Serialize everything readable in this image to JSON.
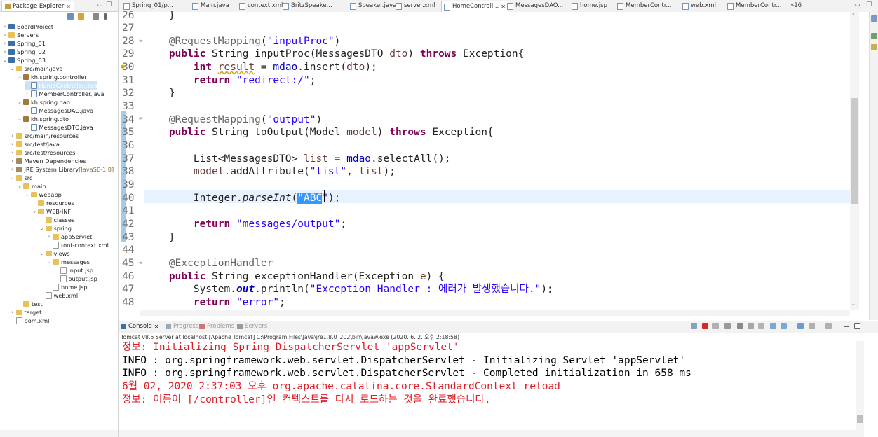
{
  "package_explorer": {
    "title": "Package Explorer",
    "tree": [
      {
        "label": "BoardProject",
        "depth": 0,
        "icon": "project",
        "toggle": "collapsed"
      },
      {
        "label": "Servers",
        "depth": 0,
        "icon": "folder",
        "toggle": "collapsed"
      },
      {
        "label": "Spring_01",
        "depth": 0,
        "icon": "project",
        "toggle": "collapsed"
      },
      {
        "label": "Spring_02",
        "depth": 0,
        "icon": "project",
        "toggle": "collapsed"
      },
      {
        "label": "Spring_03",
        "depth": 0,
        "icon": "project",
        "toggle": "expanded"
      },
      {
        "label": "src/main/java",
        "depth": 1,
        "icon": "folder",
        "toggle": "expanded"
      },
      {
        "label": "kh.spring.controller",
        "depth": 2,
        "icon": "package",
        "toggle": "expanded"
      },
      {
        "label": "HomeController.java",
        "depth": 3,
        "icon": "java",
        "toggle": "collapsed",
        "selected": true
      },
      {
        "label": "MemberController.java",
        "depth": 3,
        "icon": "java",
        "toggle": "collapsed"
      },
      {
        "label": "kh.spring.dao",
        "depth": 2,
        "icon": "package",
        "toggle": "expanded"
      },
      {
        "label": "MessagesDAO.java",
        "depth": 3,
        "icon": "java",
        "toggle": "collapsed"
      },
      {
        "label": "kh.spring.dto",
        "depth": 2,
        "icon": "package",
        "toggle": "expanded"
      },
      {
        "label": "MessagesDTO.java",
        "depth": 3,
        "icon": "java",
        "toggle": "collapsed"
      },
      {
        "label": "src/main/resources",
        "depth": 1,
        "icon": "folder",
        "toggle": "collapsed"
      },
      {
        "label": "src/test/java",
        "depth": 1,
        "icon": "folder",
        "toggle": "collapsed"
      },
      {
        "label": "src/test/resources",
        "depth": 1,
        "icon": "folder",
        "toggle": "collapsed"
      },
      {
        "label": "Maven Dependencies",
        "depth": 1,
        "icon": "library",
        "toggle": "collapsed"
      },
      {
        "label": "JRE System Library",
        "suffix": " [JavaSE-1.8]",
        "depth": 1,
        "icon": "library",
        "toggle": "collapsed"
      },
      {
        "label": "src",
        "depth": 1,
        "icon": "folder",
        "toggle": "expanded"
      },
      {
        "label": "main",
        "depth": 2,
        "icon": "folder",
        "toggle": "expanded"
      },
      {
        "label": "webapp",
        "depth": 3,
        "icon": "folder",
        "toggle": "expanded"
      },
      {
        "label": "resources",
        "depth": 4,
        "icon": "folder",
        "toggle": "none"
      },
      {
        "label": "WEB-INF",
        "depth": 4,
        "icon": "folder",
        "toggle": "expanded"
      },
      {
        "label": "classes",
        "depth": 5,
        "icon": "folder",
        "toggle": "none"
      },
      {
        "label": "spring",
        "depth": 5,
        "icon": "folder",
        "toggle": "expanded"
      },
      {
        "label": "appServlet",
        "depth": 6,
        "icon": "folder",
        "toggle": "collapsed"
      },
      {
        "label": "root-context.xml",
        "depth": 6,
        "icon": "file",
        "toggle": "none"
      },
      {
        "label": "views",
        "depth": 5,
        "icon": "folder",
        "toggle": "expanded"
      },
      {
        "label": "messages",
        "depth": 6,
        "icon": "folder",
        "toggle": "expanded"
      },
      {
        "label": "input.jsp",
        "depth": 7,
        "icon": "file",
        "toggle": "none"
      },
      {
        "label": "output.jsp",
        "depth": 7,
        "icon": "file",
        "toggle": "none"
      },
      {
        "label": "home.jsp",
        "depth": 6,
        "icon": "file",
        "toggle": "none"
      },
      {
        "label": "web.xml",
        "depth": 5,
        "icon": "file",
        "toggle": "none"
      },
      {
        "label": "test",
        "depth": 2,
        "icon": "folder",
        "toggle": "none"
      },
      {
        "label": "target",
        "depth": 1,
        "icon": "folder",
        "toggle": "collapsed"
      },
      {
        "label": "pom.xml",
        "depth": 1,
        "icon": "file",
        "toggle": "none"
      }
    ]
  },
  "editor_tabs": [
    {
      "label": "Spring_01/p..."
    },
    {
      "label": "Main.java"
    },
    {
      "label": "context.xml"
    },
    {
      "label": "BritzSpeake..."
    },
    {
      "label": "Speaker.java"
    },
    {
      "label": "server.xml"
    },
    {
      "label": "HomeControll...",
      "active": true
    },
    {
      "label": "MessagesDAO..."
    },
    {
      "label": "home.jsp"
    },
    {
      "label": "MemberContr..."
    },
    {
      "label": "web.xml"
    },
    {
      "label": "MemberContr..."
    },
    {
      "label": "»26"
    }
  ],
  "editor": {
    "lines": [
      {
        "n": "26",
        "tokens": [
          [
            "t",
            "    }"
          ]
        ]
      },
      {
        "n": "27",
        "tokens": []
      },
      {
        "n": "28",
        "fold": true,
        "tokens": [
          [
            "ann",
            "    @RequestMapping"
          ],
          [
            "t",
            "("
          ],
          [
            "str",
            "\"inputProc\""
          ],
          [
            "t",
            ")"
          ]
        ]
      },
      {
        "n": "29",
        "tokens": [
          [
            "kw",
            "    public"
          ],
          [
            "t",
            " String inputProc(MessagesDTO "
          ],
          [
            "var",
            "dto"
          ],
          [
            "t",
            ") "
          ],
          [
            "kw",
            "throws"
          ],
          [
            "t",
            " Exception{"
          ]
        ]
      },
      {
        "n": "30",
        "warn": true,
        "tokens": [
          [
            "kw",
            "        int"
          ],
          [
            "t",
            " "
          ],
          [
            "var",
            "result"
          ],
          [
            "t",
            " = "
          ],
          [
            "fld",
            "mdao"
          ],
          [
            "t",
            ".insert("
          ],
          [
            "var",
            "dto"
          ],
          [
            "t",
            ");"
          ]
        ]
      },
      {
        "n": "31",
        "tokens": [
          [
            "kw",
            "        return"
          ],
          [
            "t",
            " "
          ],
          [
            "str",
            "\"redirect:/\""
          ],
          [
            "t",
            ";"
          ]
        ]
      },
      {
        "n": "32",
        "tokens": [
          [
            "t",
            "    }"
          ]
        ]
      },
      {
        "n": "33",
        "tokens": []
      },
      {
        "n": "34",
        "fold": true,
        "tokens": [
          [
            "ann",
            "    @RequestMapping"
          ],
          [
            "t",
            "("
          ],
          [
            "str",
            "\"output\""
          ],
          [
            "t",
            ")"
          ]
        ]
      },
      {
        "n": "35",
        "tokens": [
          [
            "kw",
            "    public"
          ],
          [
            "t",
            " String toOutput(Model "
          ],
          [
            "var",
            "model"
          ],
          [
            "t",
            ") "
          ],
          [
            "kw",
            "throws"
          ],
          [
            "t",
            " Exception{"
          ]
        ]
      },
      {
        "n": "36",
        "tokens": []
      },
      {
        "n": "37",
        "tokens": [
          [
            "t",
            "        List<MessagesDTO> "
          ],
          [
            "var",
            "list"
          ],
          [
            "t",
            " = "
          ],
          [
            "fld",
            "mdao"
          ],
          [
            "t",
            ".selectAll();"
          ]
        ]
      },
      {
        "n": "38",
        "tokens": [
          [
            "t",
            "        "
          ],
          [
            "var",
            "model"
          ],
          [
            "t",
            ".addAttribute("
          ],
          [
            "str",
            "\"list\""
          ],
          [
            "t",
            ", "
          ],
          [
            "var",
            "list"
          ],
          [
            "t",
            ");"
          ]
        ]
      },
      {
        "n": "39",
        "tokens": []
      },
      {
        "n": "40",
        "current": true,
        "tokens": [
          [
            "t",
            "        Integer."
          ],
          [
            "it",
            "parseInt"
          ],
          [
            "t",
            "("
          ],
          [
            "sel",
            "\"ABC"
          ],
          [
            "str",
            "\""
          ],
          [
            "t",
            ");"
          ]
        ]
      },
      {
        "n": "41",
        "tokens": []
      },
      {
        "n": "42",
        "tokens": [
          [
            "kw",
            "        return"
          ],
          [
            "t",
            " "
          ],
          [
            "str",
            "\"messages/output\""
          ],
          [
            "t",
            ";"
          ]
        ]
      },
      {
        "n": "43",
        "tokens": [
          [
            "t",
            "    }"
          ]
        ]
      },
      {
        "n": "44",
        "tokens": []
      },
      {
        "n": "45",
        "fold": true,
        "tokens": [
          [
            "ann",
            "    @ExceptionHandler"
          ]
        ]
      },
      {
        "n": "46",
        "tokens": [
          [
            "kw",
            "    public"
          ],
          [
            "t",
            " String exceptionHandler(Exception "
          ],
          [
            "var",
            "e"
          ],
          [
            "t",
            ") {"
          ]
        ]
      },
      {
        "n": "47",
        "tokens": [
          [
            "t",
            "        System."
          ],
          [
            "fldit",
            "out"
          ],
          [
            "t",
            ".println("
          ],
          [
            "str",
            "\"Exception Handler : 에러가 발생했습니다.\""
          ],
          [
            "t",
            ");"
          ]
        ]
      },
      {
        "n": "48",
        "tokens": [
          [
            "kw",
            "        return"
          ],
          [
            "t",
            " "
          ],
          [
            "str",
            "\"error\""
          ],
          [
            "t",
            ";"
          ]
        ]
      }
    ]
  },
  "console": {
    "tabs": [
      {
        "label": "Console",
        "active": true
      },
      {
        "label": "Progress"
      },
      {
        "label": "Problems"
      },
      {
        "label": "Servers"
      }
    ],
    "description": "Tomcat v8.5 Server at localhost [Apache Tomcat] C:\\Program Files\\Java\\jre1.8.0_202\\bin\\javaw.exe (2020. 6. 2. 오후 2:18:58)",
    "lines": [
      {
        "style": "err",
        "text": "정보: Initializing Spring DispatcherServlet 'appServlet'"
      },
      {
        "style": "out",
        "text": "INFO : org.springframework.web.servlet.DispatcherServlet - Initializing Servlet 'appServlet'"
      },
      {
        "style": "out",
        "text": "INFO : org.springframework.web.servlet.DispatcherServlet - Completed initialization in 658 ms"
      },
      {
        "style": "err",
        "text": "6월 02, 2020 2:37:03 오후 org.apache.catalina.core.StandardContext reload"
      },
      {
        "style": "err",
        "text": "정보: 이름이 [/controller]인 컨텍스트를 다시 로드하는 것을 완료했습니다."
      }
    ]
  },
  "colors": {
    "keyword": "#7f0055",
    "string": "#2a00ff",
    "annotation": "#646464",
    "field": "#0000c0",
    "stderr": "#e01b24",
    "selection": "#3399ff"
  }
}
